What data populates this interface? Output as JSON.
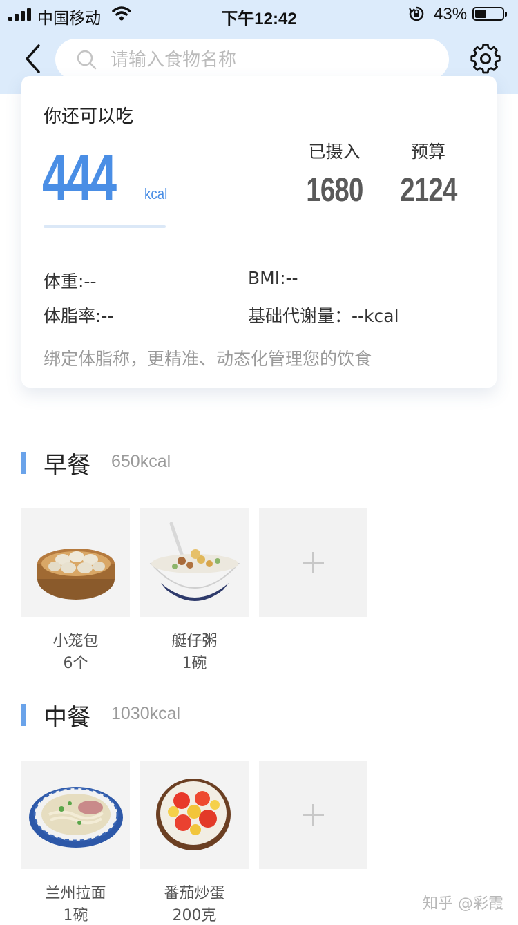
{
  "status_bar": {
    "carrier": "中国移动",
    "time": "下午12:42",
    "battery_percent": "43%",
    "battery_level": 0.43
  },
  "header": {
    "search_placeholder": "请输入食物名称",
    "icons": {
      "back": "chevron-left-icon",
      "search": "search-icon",
      "settings": "gear-icon"
    }
  },
  "summary": {
    "can_eat_label": "你还可以吃",
    "remaining_value": "444",
    "remaining_unit": "kcal",
    "intake_label": "已摄入",
    "intake_value": "1680",
    "budget_label": "预算",
    "budget_value": "2124",
    "weight_text": "体重:--",
    "bmi_text": "BMI:--",
    "body_fat_text": "体脂率:--",
    "bmr_text": "基础代谢量：--kcal",
    "bind_scale_tip": "绑定体脂称，更精准、动态化管理您的饮食"
  },
  "meals": {
    "breakfast": {
      "title": "早餐",
      "kcal": "650kcal",
      "items": [
        {
          "name": "小笼包",
          "qty": "6个",
          "icon": "steamed-buns-image"
        },
        {
          "name": "艇仔粥",
          "qty": "1碗",
          "icon": "congee-bowl-image"
        }
      ]
    },
    "lunch": {
      "title": "中餐",
      "kcal": "1030kcal",
      "items": [
        {
          "name": "兰州拉面",
          "qty": "1碗",
          "icon": "noodle-bowl-image"
        },
        {
          "name": "番茄炒蛋",
          "qty": "200克",
          "icon": "tomato-egg-image"
        }
      ]
    }
  },
  "colors": {
    "accent": "#4a8ee5",
    "header_bg": "#dcebfb",
    "section_bar": "#6aa3ea"
  },
  "watermark": "知乎 @彩霞"
}
